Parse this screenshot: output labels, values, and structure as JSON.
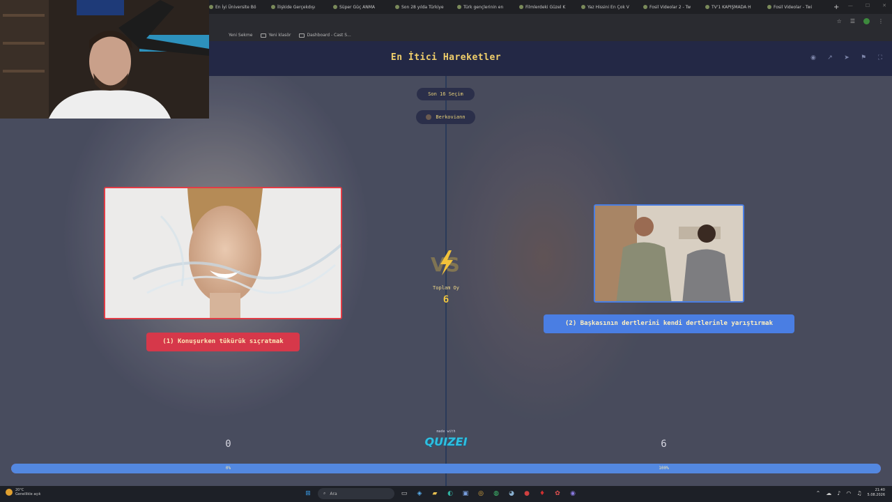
{
  "browser": {
    "tabs": [
      "En İyi Üniversite Bö",
      "İlişkide Gerçekdışı",
      "Süper Güç ANMA",
      "Son 28 yılda Türkiye",
      "Türk gençlerinin en",
      "Filmlerdeki Güzel K",
      "Yaz Hissini En Çok V",
      "Fosil Videolar 2 - Tw",
      "TV'1 KAPIŞMADA H",
      "Fosil Videolar - Twi"
    ],
    "new_tab": "+",
    "bookmarks": [
      "Yeni Sekme",
      "Yeni klasör",
      "Dashboard - Cast S..."
    ]
  },
  "quiz": {
    "title": "En İtici Hareketler",
    "round_pill": "Son 16 Seçim",
    "user_name": "Berkoviann",
    "total_votes_label": "Toplam Oy",
    "total_votes": "6",
    "made_with": "made with",
    "brand": "QUIZEI",
    "left": {
      "label": "(1) Konuşurken tükürük sıçratmak",
      "votes": "0",
      "percent_label": "0%",
      "image_desc": "woman-splash-photo",
      "accent": "#e23c46"
    },
    "right": {
      "label": "(2) Başkasının dertlerini kendi dertlerinle yarıştırmak",
      "votes": "6",
      "percent_label": "100%",
      "image_desc": "arguing-couple-photo",
      "accent": "#4a7ee3"
    },
    "right_share": 1.0
  },
  "taskbar": {
    "weather_temp": "20°C",
    "weather_desc": "Genellikle açık",
    "search_placeholder": "Ara",
    "time": "21:40",
    "date": "5.08.2026"
  }
}
